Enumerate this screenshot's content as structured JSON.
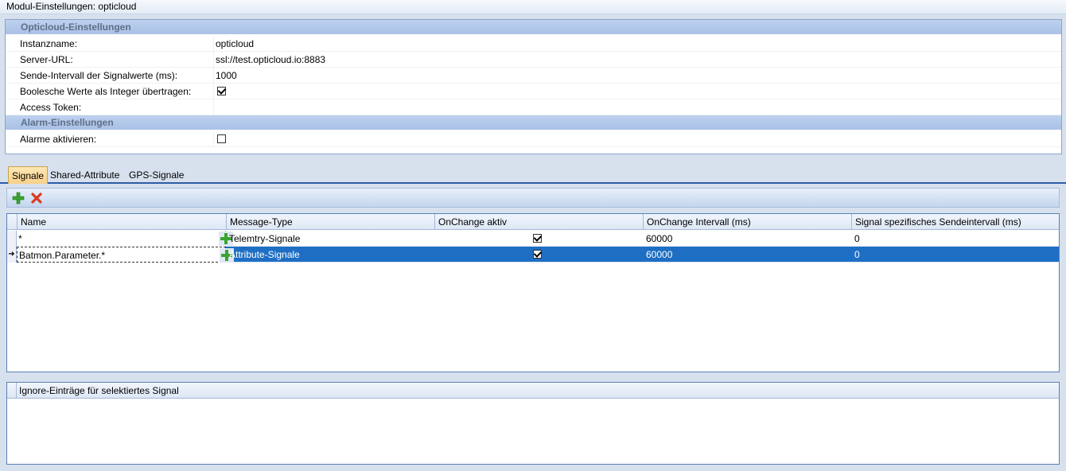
{
  "window": {
    "title": "Modul-Einstellungen: opticloud"
  },
  "settings": {
    "section1_title": "Opticloud-Einstellungen",
    "instance_label": "Instanzname:",
    "instance_value": "opticloud",
    "server_label": "Server-URL:",
    "server_value": "ssl://test.opticloud.io:8883",
    "interval_label": "Sende-Intervall der Signalwerte (ms):",
    "interval_value": "1000",
    "bool_label": "Boolesche Werte als Integer übertragen:",
    "bool_checked": true,
    "token_label": "Access Token:",
    "token_value": "",
    "section2_title": "Alarm-Einstellungen",
    "alarm_label": "Alarme aktivieren:",
    "alarm_checked": false
  },
  "tabs": [
    {
      "label": "Signale",
      "active": true
    },
    {
      "label": "Shared-Attribute",
      "active": false
    },
    {
      "label": "GPS-Signale",
      "active": false
    }
  ],
  "toolbar": {
    "add_icon": "plus-icon",
    "delete_icon": "x-icon"
  },
  "grid": {
    "columns": [
      "Name",
      "Message-Type",
      "OnChange aktiv",
      "OnChange Intervall (ms)",
      "Signal spezifisches Sendeintervall (ms)"
    ],
    "rows": [
      {
        "name": "*",
        "message_type": "Telemtry-Signale",
        "onchange_active": true,
        "onchange_interval": "60000",
        "send_interval": "0",
        "selected": false
      },
      {
        "name": "Batmon.Parameter.*",
        "message_type": "Attribute-Signale",
        "onchange_active": true,
        "onchange_interval": "60000",
        "send_interval": "0",
        "selected": true
      }
    ],
    "row_indicator": "➜"
  },
  "ignore": {
    "title": "Ignore-Einträge für selektiertes Signal"
  },
  "colors": {
    "selection": "#1e6fc4",
    "header": "#a9c1e6",
    "add_green": "#3aa52e",
    "delete_red": "#d93a1f"
  }
}
